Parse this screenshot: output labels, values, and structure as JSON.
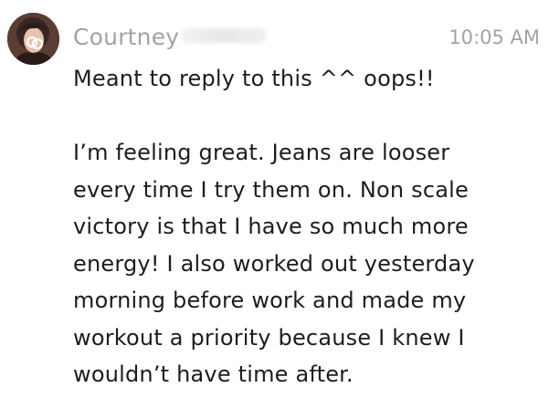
{
  "message": {
    "avatar_icon": "user-avatar-photo",
    "sender_name": "Courtney",
    "timestamp": "10:05 AM",
    "lines": [
      "Meant to reply to this ^^ oops!!",
      "",
      "I’m feeling great. Jeans are looser",
      "every time I try them on. Non scale",
      "victory is that I have so much more",
      "energy! I also worked out yesterday",
      "morning before work and made my",
      "workout a priority because I knew I",
      "wouldn’t have time after."
    ]
  },
  "colors": {
    "meta_text": "#a3a3a3",
    "body_text": "#1d1d1d",
    "background": "#ffffff"
  }
}
